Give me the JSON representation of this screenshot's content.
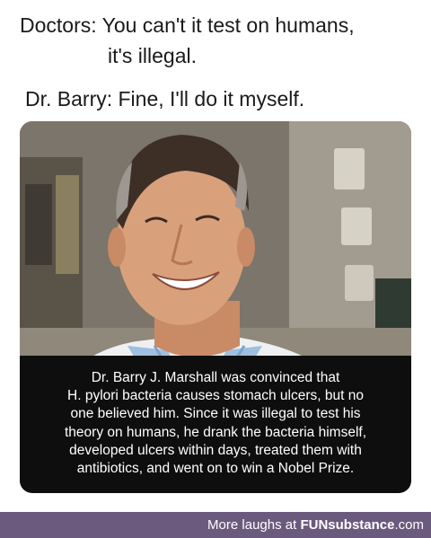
{
  "caption": {
    "line1": "Doctors: You can't it test on humans,",
    "line2": "it's illegal.",
    "line3": "Dr. Barry: Fine, I'll do it myself."
  },
  "info": {
    "lines": [
      "Dr. Barry J. Marshall was convinced that",
      "H. pylori bacteria causes stomach ulcers, but no",
      "one believed him. Since it was illegal to test his",
      "theory on humans, he drank the bacteria himself,",
      "developed ulcers within days, treated them with",
      "antibiotics, and went on to win a Nobel Prize."
    ]
  },
  "footer": {
    "prefix": "More laughs at",
    "brand": "FUNsubstance",
    "suffix": ".com"
  },
  "colors": {
    "footer_bg": "#6b5a7d",
    "box_bg": "#0e0e0e"
  }
}
